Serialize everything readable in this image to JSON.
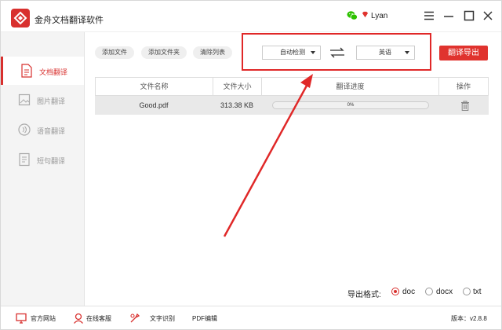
{
  "app": {
    "title": "金舟文档翻译软件"
  },
  "user": {
    "name": "Lyan"
  },
  "sidebar": {
    "items": [
      {
        "label": "文档翻译",
        "icon": "document-icon"
      },
      {
        "label": "图片翻译",
        "icon": "image-icon"
      },
      {
        "label": "语音翻译",
        "icon": "voice-icon"
      },
      {
        "label": "短句翻译",
        "icon": "text-icon"
      }
    ]
  },
  "toolbar": {
    "add_file": "添加文件",
    "add_folder": "添加文件夹",
    "clear_list": "清除列表",
    "source_lang": "自动检测",
    "target_lang": "英语",
    "export": "翻译导出"
  },
  "table": {
    "headers": [
      "文件名称",
      "文件大小",
      "翻译进度",
      "操作"
    ],
    "rows": [
      {
        "name": "Good.pdf",
        "size": "313.38 KB",
        "progress": "0%"
      }
    ]
  },
  "export_format": {
    "label": "导出格式:",
    "options": [
      "doc",
      "docx",
      "txt"
    ],
    "selected": "doc"
  },
  "footer": {
    "website": "官方网站",
    "support": "在线客服",
    "ocr": "文字识别",
    "pdf": "PDF编辑",
    "version": "版本：v2.8.8"
  },
  "colors": {
    "accent": "#d8302e",
    "annotation": "#e02828"
  }
}
